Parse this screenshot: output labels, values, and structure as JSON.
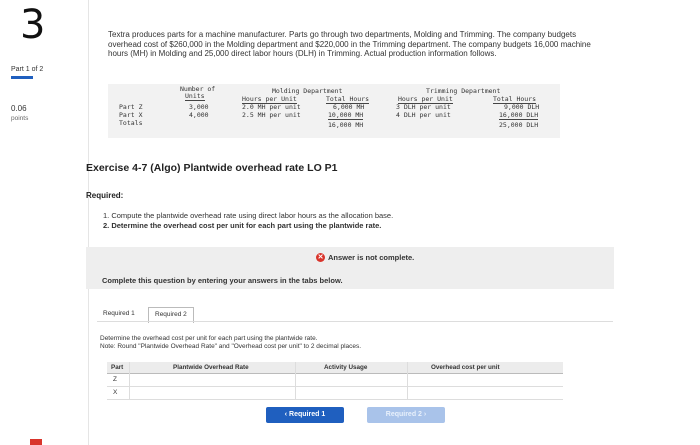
{
  "sidebar": {
    "question_number": "3",
    "part_label": "Part 1 of 2",
    "points_value": "0.06",
    "points_label": "points"
  },
  "intro": "Textra produces parts for a machine manufacturer. Parts go through two departments, Molding and Trimming. The company budgets overhead cost of $260,000 in the Molding department and $220,000 in the Trimming department. The company budgets 16,000 machine hours (MH) in Molding and 25,000 direct labor hours (DLH) in Trimming. Actual production information follows.",
  "data_table": {
    "col_number_units_1": "Number of",
    "col_number_units_2": "Units",
    "molding_header": "Molding Department",
    "molding_hpu": "Hours per Unit",
    "molding_total": "Total Hours",
    "trimming_header": "Trimming Department",
    "trimming_hpu": "Hours per Unit",
    "trimming_total": "Total Hours",
    "rows": [
      {
        "label": "Part Z",
        "units": "3,000",
        "m_hpu": "2.0 MH per unit",
        "m_total": "6,000 MH",
        "t_hpu": "3 DLH per unit",
        "t_total": "9,000 DLH"
      },
      {
        "label": "Part X",
        "units": "4,000",
        "m_hpu": "2.5 MH per unit",
        "m_total": "10,000 MH",
        "t_hpu": "4 DLH per unit",
        "t_total": "16,000 DLH"
      }
    ],
    "totals_label": "Totals",
    "m_grand_total": "16,000 MH",
    "t_grand_total": "25,000 DLH"
  },
  "exercise_title": "Exercise 4-7 (Algo) Plantwide overhead rate LO P1",
  "required_heading": "Required:",
  "required_items": [
    "1. Compute the plantwide overhead rate using direct labor hours as the allocation base.",
    "2. Determine the overhead cost per unit for each part using the plantwide rate."
  ],
  "status": {
    "icon": "x-circle-icon",
    "text": "Answer is not complete."
  },
  "complete_instruction": "Complete this question by entering your answers in the tabs below.",
  "tabs": [
    {
      "label": "Required 1"
    },
    {
      "label": "Required 2"
    }
  ],
  "tab_instructions": {
    "line1": "Determine the overhead cost per unit for each part using the plantwide rate.",
    "line2": "Note: Round \"Plantwide Overhead Rate\" and \"Overhead cost per unit\" to 2 decimal places."
  },
  "answer_table": {
    "headers": [
      "Part",
      "Plantwide Overhead Rate",
      "Activity Usage",
      "Overhead cost per unit"
    ],
    "rows": [
      "Z",
      "X"
    ]
  },
  "nav": {
    "prev_label": "Required 1",
    "next_label": "Required 2"
  },
  "colors": {
    "accent": "#1f5fbf",
    "error": "#d9342b"
  }
}
